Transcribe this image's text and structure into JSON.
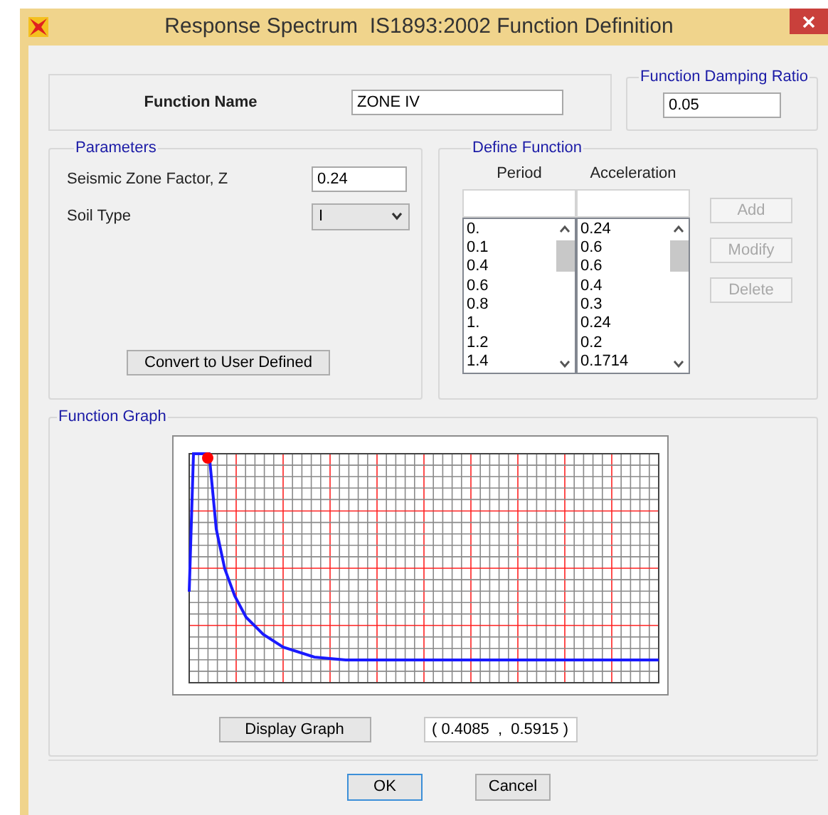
{
  "window": {
    "title": "Response Spectrum  IS1893:2002 Function Definition"
  },
  "function_name": {
    "label": "Function Name",
    "value": "ZONE IV"
  },
  "damping": {
    "legend": "Function Damping Ratio",
    "value": "0.05"
  },
  "parameters": {
    "legend": "Parameters",
    "fields": [
      {
        "kind": "input",
        "label": "Seismic Zone Factor, Z",
        "value": "0.24"
      },
      {
        "kind": "select",
        "label": "Soil Type",
        "value": "I"
      }
    ],
    "convert_button": "Convert to User Defined"
  },
  "define_function": {
    "legend": "Define Function",
    "columns": [
      "Period",
      "Acceleration"
    ],
    "period_list": [
      "0.",
      "0.1",
      "0.4",
      "0.6",
      "0.8",
      "1.",
      "1.2",
      "1.4"
    ],
    "acceleration_list": [
      "0.24",
      "0.6",
      "0.6",
      "0.4",
      "0.3",
      "0.24",
      "0.2",
      "0.1714"
    ],
    "buttons": [
      {
        "label": "Add",
        "disabled": true
      },
      {
        "label": "Modify",
        "disabled": true
      },
      {
        "label": "Delete",
        "disabled": true
      }
    ]
  },
  "function_graph": {
    "legend": "Function Graph",
    "display_button": "Display Graph",
    "readout": "( 0.4085  ,  0.5915 )"
  },
  "buttons": [
    {
      "label": "OK",
      "default": true
    },
    {
      "label": "Cancel",
      "default": false
    }
  ]
}
